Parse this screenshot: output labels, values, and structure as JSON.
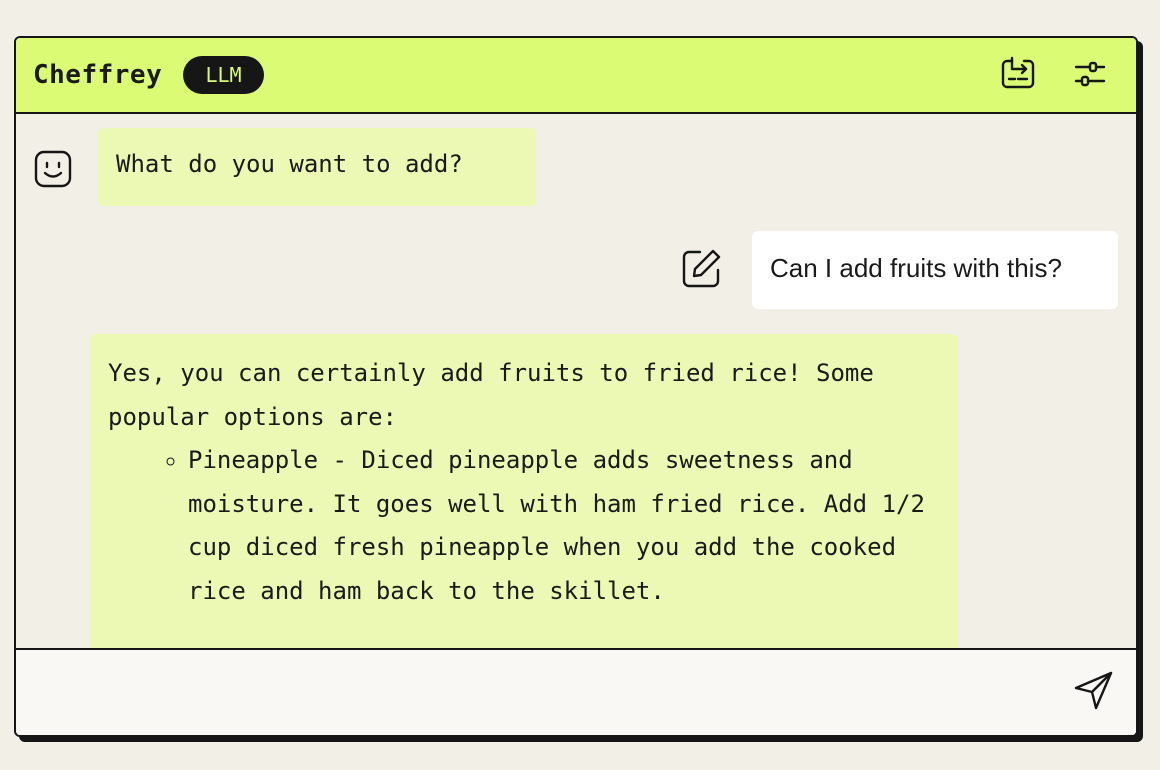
{
  "header": {
    "title": "Cheffrey",
    "badge": "LLM",
    "icons": {
      "switch": "switch-model-icon",
      "settings": "sliders-icon"
    },
    "accent": "#dbfb74"
  },
  "messages": {
    "bot1": {
      "text": "What do you want to add?",
      "icon": "robot-face-icon"
    },
    "user1": {
      "text": "Can I add fruits with this?",
      "icon": "edit-icon"
    },
    "bot2": {
      "intro": "Yes, you can certainly add fruits to fried rice! Some popular options are:",
      "items": [
        "Pineapple - Diced pineapple adds sweetness and moisture. It goes well with ham fried rice. Add 1/2 cup diced fresh pineapple when you add the cooked rice and ham back to the skillet."
      ]
    }
  },
  "composer": {
    "value": "",
    "placeholder": "",
    "send_icon": "send-icon"
  },
  "colors": {
    "bot_bubble": "#ebf9b5",
    "user_bubble": "#ffffff",
    "background": "#f2efe6",
    "border": "#161616"
  }
}
